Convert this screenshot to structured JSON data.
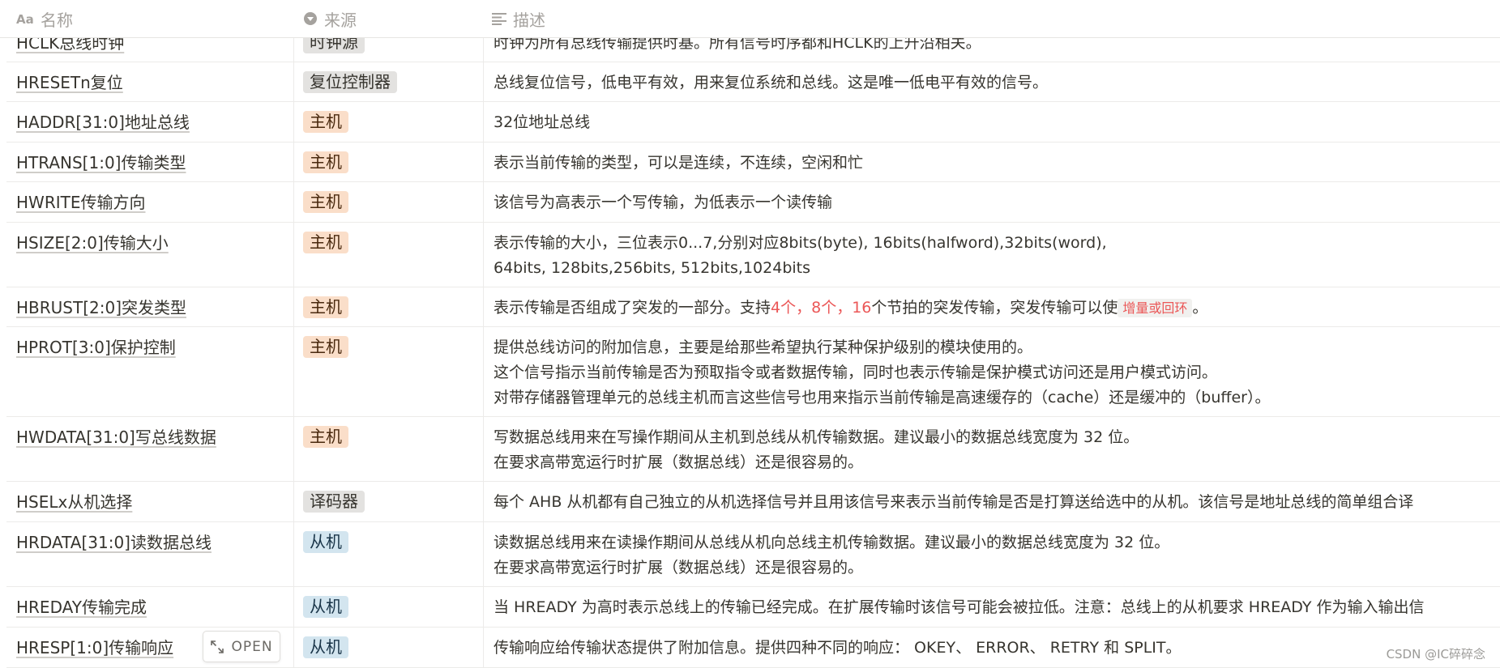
{
  "header": {
    "name": "名称",
    "source": "来源",
    "description": "描述"
  },
  "rows": [
    {
      "name": "HCLK总线时钟",
      "source": "时钟源",
      "tag": "gray",
      "desc": [
        "时钟为所有总线传输提供时基。所有信号时序都和HCLK的上升沿相关。"
      ]
    },
    {
      "name": "HRESETn复位",
      "source": "复位控制器",
      "tag": "gray",
      "desc": [
        "总线复位信号，低电平有效，用来复位系统和总线。这是唯一低电平有效的信号。"
      ]
    },
    {
      "name": "HADDR[31:0]地址总线",
      "source": "主机",
      "tag": "orange",
      "desc": [
        "32位地址总线"
      ]
    },
    {
      "name": "HTRANS[1:0]传输类型",
      "source": "主机",
      "tag": "orange",
      "desc": [
        "表示当前传输的类型，可以是连续，不连续，空闲和忙"
      ]
    },
    {
      "name": "HWRITE传输方向",
      "source": "主机",
      "tag": "orange",
      "desc": [
        "该信号为高表示一个写传输，为低表示一个读传输"
      ]
    },
    {
      "name": "HSIZE[2:0]传输大小",
      "source": "主机",
      "tag": "orange",
      "desc": [
        "表示传输的大小，三位表示0...7,分别对应8bits(byte), 16bits(halfword),32bits(word),",
        "64bits, 128bits,256bits, 512bits,1024bits"
      ]
    },
    {
      "name": "HBRUST[2:0]突发类型",
      "source": "主机",
      "tag": "orange",
      "desc_parts": {
        "a": "表示传输是否组成了突发的一部分。支持",
        "b": "4个，8个，16",
        "c": "个节拍的突发传输，突发传输可以使",
        "code": "增量或回环",
        "d": "。"
      }
    },
    {
      "name": "HPROT[3:0]保护控制",
      "source": "主机",
      "tag": "orange",
      "desc": [
        "提供总线访问的附加信息，主要是给那些希望执行某种保护级别的模块使用的。",
        "这个信号指示当前传输是否为预取指令或者数据传输，同时也表示传输是保护模式访问还是用户模式访问。",
        "对带存储器管理单元的总线主机而言这些信号也用来指示当前传输是高速缓存的（cache）还是缓冲的（buffer）。"
      ]
    },
    {
      "name": "HWDATA[31:0]写总线数据",
      "source": "主机",
      "tag": "orange",
      "desc": [
        "写数据总线用来在写操作期间从主机到总线从机传输数据。建议最小的数据总线宽度为 32 位。",
        "在要求高带宽运行时扩展（数据总线）还是很容易的。"
      ]
    },
    {
      "name": "HSELx从机选择",
      "source": "译码器",
      "tag": "gray",
      "desc": [
        "每个 AHB 从机都有自己独立的从机选择信号并且用该信号来表示当前传输是否是打算送给选中的从机。该信号是地址总线的简单组合译"
      ]
    },
    {
      "name": "HRDATA[31:0]读数据总线",
      "source": "从机",
      "tag": "blue",
      "desc": [
        "读数据总线用来在读操作期间从总线从机向总线主机传输数据。建议最小的数据总线宽度为 32 位。",
        "在要求高带宽运行时扩展（数据总线）还是很容易的。"
      ]
    },
    {
      "name": "HREDAY传输完成",
      "source": "从机",
      "tag": "blue",
      "desc": [
        "当 HREADY 为高时表示总线上的传输已经完成。在扩展传输时该信号可能会被拉低。注意：总线上的从机要求 HREADY 作为输入输出信"
      ]
    },
    {
      "name": "HRESP[1:0]传输响应",
      "source": "从机",
      "tag": "blue",
      "desc": [
        "传输响应给传输状态提供了附加信息。提供四种不同的响应： OKEY、 ERROR、 RETRY 和 SPLIT。"
      ]
    }
  ],
  "open_button": "OPEN",
  "watermark": "CSDN @IC碎碎念",
  "colors": {
    "tag_gray": "#e3e2e0",
    "tag_orange": "#fadec9",
    "tag_blue": "#d3e5ef",
    "highlight_red": "#eb5757"
  }
}
